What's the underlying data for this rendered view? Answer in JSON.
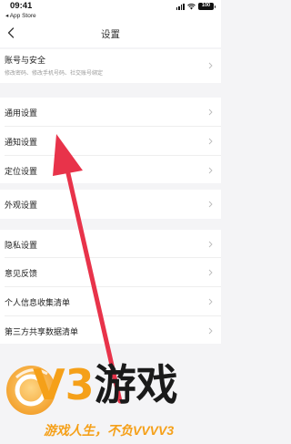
{
  "status_bar": {
    "time": "09:41",
    "back_app": "◂ App Store",
    "battery": "100"
  },
  "nav": {
    "title": "设置"
  },
  "account": {
    "label": "账号与安全",
    "sub": "修改密码、修改手机号码、社交账号绑定"
  },
  "items": [
    {
      "label": "通用设置"
    },
    {
      "label": "通知设置"
    },
    {
      "label": "定位设置"
    },
    {
      "label": "外观设置"
    },
    {
      "label": "隐私设置"
    },
    {
      "label": "意见反馈"
    },
    {
      "label": "个人信息收集清单"
    },
    {
      "label": "第三方共享数据清单"
    }
  ],
  "watermark": {
    "brand": "V3",
    "name": "游戏",
    "slogan": "游戏人生，不负VVVV3"
  },
  "colors": {
    "arrow": "#e8334a",
    "accent": "#f5a019",
    "background": "#f4f4f6"
  },
  "icons": {
    "back": "chevron-left-icon",
    "row": "chevron-right-icon"
  }
}
